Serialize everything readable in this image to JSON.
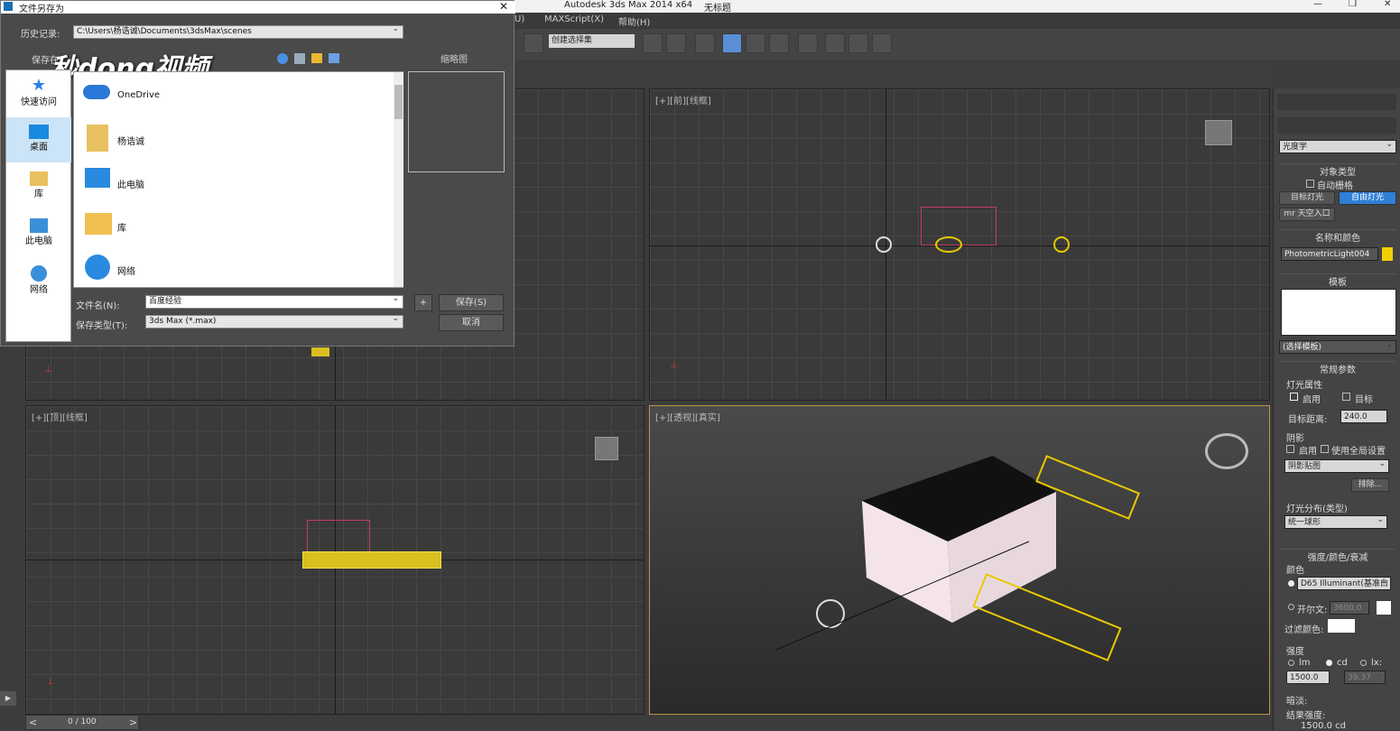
{
  "app": {
    "title": "Autodesk 3ds Max  2014 x64",
    "doc_title": "无标题"
  },
  "menu": {
    "item_u": "U)",
    "maxscript": "MAXScript(X)",
    "help": "帮助(H)"
  },
  "toolbar": {
    "selection_set": "创建选择集"
  },
  "viewports": {
    "front": "[+][前][线框]",
    "top": "[+][顶][线框]",
    "perspective": "[+][透视][真实]"
  },
  "command_panel": {
    "category": "光度学",
    "object_type": {
      "header": "对象类型",
      "autogrid": "自动栅格",
      "target_light": "目标灯光",
      "free_light": "自由灯光",
      "mr_sky": "mr 天空入口"
    },
    "name_color": {
      "header": "名称和颜色",
      "name": "PhotometricLight004",
      "swatch_color": "#f0d000"
    },
    "template": {
      "header": "模板",
      "select": "(选择模板)"
    },
    "general": {
      "header": "常规参数",
      "light_props": "灯光属性",
      "enable": "启用",
      "target": "目标",
      "target_dist_label": "目标距离:",
      "target_dist": "240.0",
      "shadows": "阴影",
      "shadow_enable": "启用",
      "use_global": "使用全局设置",
      "shadow_type": "阴影贴图",
      "exclude": "排除...",
      "dist_label": "灯光分布(类型)",
      "distribution": "统一球形"
    },
    "intensity": {
      "header": "强度/颜色/衰减",
      "color_label": "颜色",
      "preset": "D65 Illuminant(基准白",
      "kelvin_label": "开尔文:",
      "kelvin": "3600.0",
      "filter_label": "过滤颜色:",
      "strength_label": "强度",
      "lm": "lm",
      "cd": "cd",
      "lx": "lx:",
      "cd_value": "1500.0",
      "lx_value": "39.37",
      "dimming_label": "暗淡:",
      "result_label": "结果强度:",
      "result": "1500.0 cd"
    }
  },
  "timeline": {
    "frame": "0 / 100",
    "prev": "<",
    "next": ">"
  },
  "dialog": {
    "title": "文件另存为",
    "history_label": "历史记录:",
    "history_path": "C:\\Users\\杨诰诚\\Documents\\3dsMax\\scenes",
    "save_in_label": "保存在",
    "thumb_label": "缩略图",
    "watermark": "秒dong视频",
    "sidebar": [
      "快速访问",
      "桌面",
      "库",
      "此电脑",
      "网络"
    ],
    "files": [
      "OneDrive",
      "杨诰诚",
      "此电脑",
      "库",
      "网络"
    ],
    "filename_label": "文件名(N):",
    "filename": "百度经验",
    "type_label": "保存类型(T):",
    "type": "3ds Max (*.max)",
    "plus": "+",
    "save": "保存(S)",
    "cancel": "取消"
  }
}
